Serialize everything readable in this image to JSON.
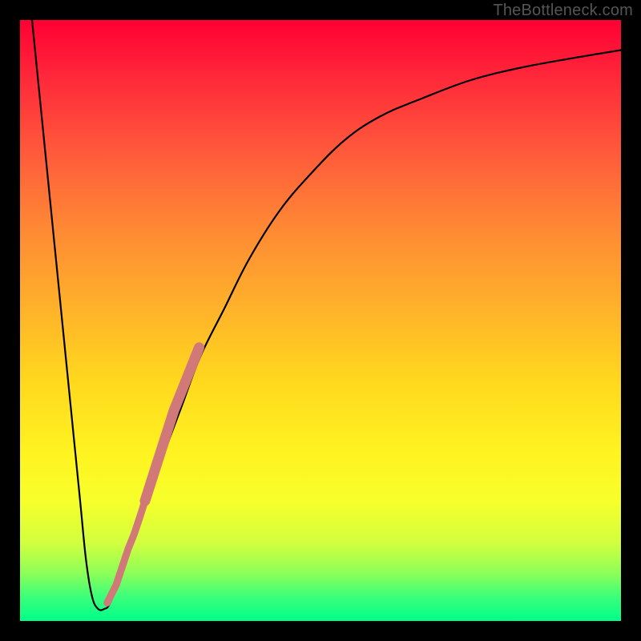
{
  "watermark": "TheBottleneck.com",
  "chart_data": {
    "type": "line",
    "title": "",
    "xlabel": "",
    "ylabel": "",
    "xlim": [
      0,
      100
    ],
    "ylim": [
      0,
      100
    ],
    "curve": {
      "name": "bottleneck-curve",
      "x": [
        2,
        4,
        6,
        8,
        10,
        11,
        12,
        13,
        14,
        15,
        17,
        19,
        21,
        24,
        27,
        30,
        34,
        38,
        43,
        48,
        54,
        60,
        67,
        75,
        83,
        91,
        100
      ],
      "y": [
        100,
        80,
        60,
        40,
        20,
        10,
        4,
        2,
        2,
        3,
        8,
        14,
        20,
        28,
        36,
        44,
        52,
        60,
        68,
        74,
        80,
        84,
        87,
        90,
        92,
        93.5,
        95
      ]
    },
    "points": {
      "name": "measured-samples",
      "x": [
        14.5,
        16.0,
        17.0,
        18.0,
        19.0,
        20.0,
        20.8,
        21.6,
        22.4,
        23.2,
        24.0,
        24.8,
        25.6,
        26.4,
        27.2,
        28.0,
        28.6,
        29.2,
        29.8
      ],
      "y": [
        3.0,
        6.0,
        9.0,
        12.0,
        14.5,
        17.5,
        20.0,
        22.5,
        25.0,
        27.5,
        30.0,
        32.5,
        35.0,
        37.0,
        39.0,
        41.0,
        42.5,
        44.0,
        45.5
      ],
      "radius": [
        3.5,
        3.5,
        3.5,
        4.0,
        4.2,
        4.4,
        4.6,
        4.8,
        5.0,
        5.2,
        5.4,
        5.6,
        5.8,
        6.0,
        6.0,
        6.2,
        6.2,
        6.4,
        6.4
      ]
    },
    "colors": {
      "curve": "#000000",
      "points": "#d17878",
      "gradient_top": "#ff0033",
      "gradient_bottom": "#00ff8a"
    }
  }
}
